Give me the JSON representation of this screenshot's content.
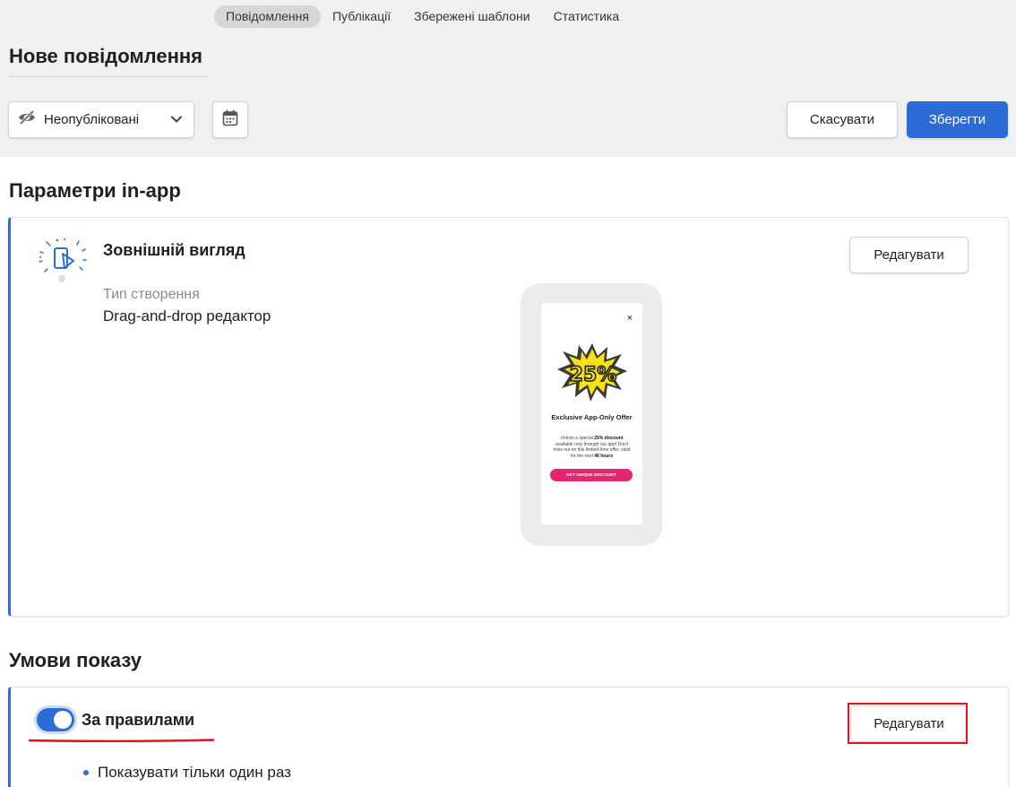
{
  "tabs": [
    {
      "label": "Повідомлення",
      "active": true
    },
    {
      "label": "Публікації",
      "active": false
    },
    {
      "label": "Збережені шаблони",
      "active": false
    },
    {
      "label": "Статистика",
      "active": false
    }
  ],
  "header": {
    "title": "Нове повідомлення",
    "status_label": "Неопубліковані",
    "status_icon": "eye-off-icon",
    "calendar_icon": "calendar-icon",
    "cancel_label": "Скасувати",
    "save_label": "Зберегти"
  },
  "inapp": {
    "section_title": "Параметри in-app",
    "appearance_title": "Зовнішній вигляд",
    "edit_label": "Редагувати",
    "type_label": "Тип створення",
    "type_value": "Drag-and-drop редактор",
    "preview": {
      "close": "×",
      "badge": "25%",
      "title": "Exclusive App-Only Offer",
      "text_pre": "Unlock a special ",
      "text_bold1": "25% discount",
      "text_mid": " available only through our app! Don't miss out on this limited-time offer, valid for the next ",
      "text_bold2": "48 hours",
      "button": "GET UNIQUE DISCOUNT",
      "button_color": "#e4266f"
    }
  },
  "conditions": {
    "section_title": "Умови показу",
    "rules_title": "За правилами",
    "rules_enabled": true,
    "edit_label": "Редагувати",
    "items": [
      "Показувати тільки один раз"
    ]
  },
  "colors": {
    "accent": "#2d6bd6",
    "annotation": "#e3141b"
  }
}
